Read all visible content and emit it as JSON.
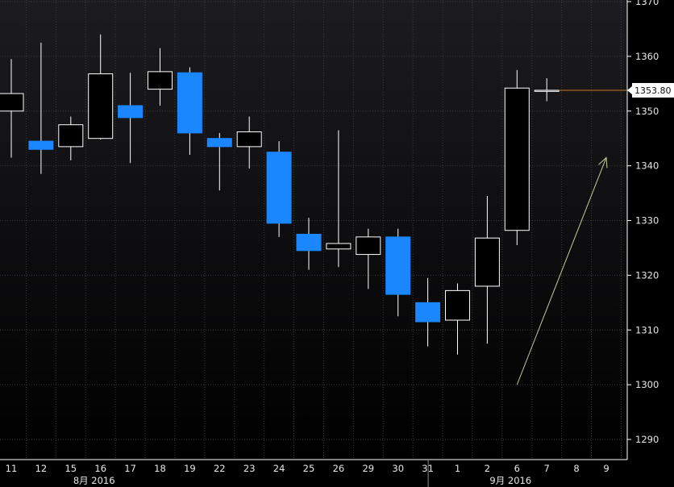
{
  "chart_data": {
    "type": "candlestick",
    "title": "",
    "xlabel": "",
    "ylabel": "",
    "ylim": [
      1285,
      1370
    ],
    "y_ticks": [
      1290,
      1300,
      1310,
      1320,
      1330,
      1340,
      1350,
      1360,
      1370
    ],
    "grid": true,
    "current_price": 1353.8,
    "current_price_label": "1353.80",
    "month_labels": [
      {
        "label": "8月 2016",
        "at_category": "16"
      },
      {
        "label": "9月 2016",
        "at_category": "6"
      }
    ],
    "categories": [
      "11",
      "12",
      "15",
      "16",
      "17",
      "18",
      "19",
      "22",
      "23",
      "24",
      "25",
      "26",
      "29",
      "30",
      "31",
      "1",
      "2",
      "6",
      "7",
      "8",
      "9"
    ],
    "candles": [
      {
        "date": "11",
        "open": 1350.0,
        "high": 1359.5,
        "low": 1341.5,
        "close": 1353.2
      },
      {
        "date": "12",
        "open": 1344.5,
        "high": 1362.5,
        "low": 1338.5,
        "close": 1343.0
      },
      {
        "date": "15",
        "open": 1343.5,
        "high": 1349.0,
        "low": 1341.0,
        "close": 1347.5
      },
      {
        "date": "16",
        "open": 1345.0,
        "high": 1364.0,
        "low": 1344.8,
        "close": 1356.8
      },
      {
        "date": "17",
        "open": 1351.0,
        "high": 1357.0,
        "low": 1340.5,
        "close": 1348.8
      },
      {
        "date": "18",
        "open": 1354.0,
        "high": 1361.5,
        "low": 1351.0,
        "close": 1357.2
      },
      {
        "date": "19",
        "open": 1357.0,
        "high": 1358.0,
        "low": 1342.0,
        "close": 1346.0
      },
      {
        "date": "22",
        "open": 1345.0,
        "high": 1346.0,
        "low": 1335.5,
        "close": 1343.5
      },
      {
        "date": "23",
        "open": 1343.5,
        "high": 1349.0,
        "low": 1339.5,
        "close": 1346.2
      },
      {
        "date": "24",
        "open": 1342.5,
        "high": 1344.5,
        "low": 1327.0,
        "close": 1329.5
      },
      {
        "date": "25",
        "open": 1327.5,
        "high": 1330.5,
        "low": 1321.0,
        "close": 1324.5
      },
      {
        "date": "26",
        "open": 1324.8,
        "high": 1346.5,
        "low": 1321.5,
        "close": 1325.8
      },
      {
        "date": "29",
        "open": 1323.8,
        "high": 1328.5,
        "low": 1317.5,
        "close": 1327.0
      },
      {
        "date": "30",
        "open": 1327.0,
        "high": 1328.5,
        "low": 1312.5,
        "close": 1316.5
      },
      {
        "date": "31",
        "open": 1315.0,
        "high": 1319.5,
        "low": 1307.0,
        "close": 1311.5
      },
      {
        "date": "1",
        "open": 1311.8,
        "high": 1318.5,
        "low": 1305.5,
        "close": 1317.2
      },
      {
        "date": "2",
        "open": 1318.0,
        "high": 1334.5,
        "low": 1307.5,
        "close": 1326.8
      },
      {
        "date": "6",
        "open": 1328.2,
        "high": 1357.5,
        "low": 1325.5,
        "close": 1354.2
      },
      {
        "date": "7",
        "open": 1353.6,
        "high": 1356.0,
        "low": 1351.8,
        "close": 1353.8
      }
    ],
    "annotations": [
      {
        "type": "arrow",
        "from": {
          "x": "6",
          "y": 1300
        },
        "to": {
          "x": "9",
          "y": 1341.5
        }
      }
    ],
    "colors": {
      "background": "#000000",
      "up_body": "#000000",
      "up_outline": "#ffffff",
      "down_body": "#1a86ff",
      "wick": "#ffffff",
      "grid": "#3a3a3a",
      "price_line": "#c8781e",
      "price_label_bg": "#ffffff",
      "arrow": "#c8c8a0",
      "axis": "#ffffff"
    }
  }
}
